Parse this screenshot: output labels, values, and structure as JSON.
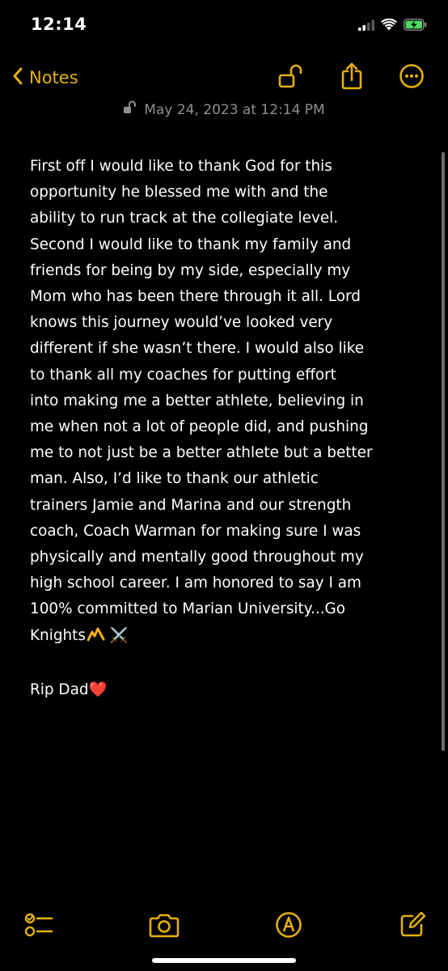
{
  "status_bar": {
    "time": "12:14",
    "icons": [
      "cellular-signal-icon",
      "wifi-icon",
      "battery-charging-icon"
    ]
  },
  "nav": {
    "back_label": "Notes",
    "icons": [
      "lock-open-icon",
      "share-icon",
      "more-icon"
    ]
  },
  "note": {
    "date": "May 24, 2023 at 12:14 PM",
    "lines": [
      "First off I would like to thank God for this",
      "opportunity he blessed me with and the",
      "ability to run track at the collegiate level.",
      "Second I would like to thank my family and",
      "friends for being by my side, especially my",
      "Mom who has been there through it all. Lord",
      "knows this journey would’ve looked very",
      "different if she wasn’t there. I would also like",
      "to thank all my coaches for putting effort",
      "into making me a better athlete, believing in",
      "me when not a lot of people did, and pushing",
      "me to not just be a better athlete but a better",
      "man. Also, I’d like to thank our athletic",
      "trainers Jamie and Marina and our strength",
      "coach, Coach Warman for making sure I was",
      "physically and mentally good throughout my",
      "high school career. I am honored to say I am",
      "100% committed to Marian University...Go"
    ],
    "last_line_text": "Knights",
    "last_line_emoji": "⚔️",
    "closing_text": "Rip Dad",
    "closing_emoji": "❤️"
  },
  "toolbar": {
    "icons": [
      "checklist-icon",
      "camera-icon",
      "markup-icon",
      "compose-icon"
    ]
  },
  "colors": {
    "accent": "#E5B00F",
    "background": "#000000",
    "text": "#FFFFFF",
    "secondary_text": "#8E8E93",
    "battery_green": "#4CD964",
    "heart_red": "#E02020"
  }
}
